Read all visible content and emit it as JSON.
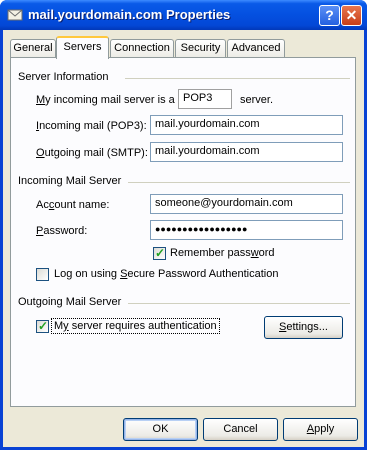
{
  "window": {
    "title": "mail.yourdomain.com Properties",
    "help_glyph": "?",
    "close_glyph": "✕"
  },
  "tabs": [
    {
      "label": "General"
    },
    {
      "label": "Servers"
    },
    {
      "label": "Connection"
    },
    {
      "label": "Security"
    },
    {
      "label": "Advanced"
    }
  ],
  "server_info": {
    "heading": "Server Information",
    "server_type_prefix": "y incoming mail server is a",
    "server_type_accel": "M",
    "server_type_value": "POP3",
    "server_type_suffix": "server.",
    "incoming_label_accel": "I",
    "incoming_label_rest": "ncoming mail (POP3):",
    "incoming_value": "mail.yourdomain.com",
    "outgoing_label_accel": "O",
    "outgoing_label_rest": "utgoing mail (SMTP):",
    "outgoing_value": "mail.yourdomain.com"
  },
  "incoming_server": {
    "heading": "Incoming Mail Server",
    "account_label_rest_pre": "Ac",
    "account_label_accel": "c",
    "account_label_rest_post": "ount name:",
    "account_value": "someone@yourdomain.com",
    "password_label_accel": "P",
    "password_label_rest": "assword:",
    "password_value": "●●●●●●●●●●●●●●●●●",
    "remember_pre": "Remember pass",
    "remember_accel": "w",
    "remember_post": "ord",
    "remember_checked": true,
    "spa_pre": "Log on using ",
    "spa_accel": "S",
    "spa_post": "ecure Password Authentication",
    "spa_checked": false
  },
  "outgoing_server": {
    "heading": "Outgoing Mail Server",
    "auth_pre": "M",
    "auth_accel": "y",
    "auth_post": " server requires authentication",
    "auth_checked": true,
    "settings_label_accel": "S",
    "settings_label_rest": "ettings..."
  },
  "buttons": {
    "ok": "OK",
    "cancel": "Cancel",
    "apply_accel": "A",
    "apply_rest": "pply"
  },
  "colors": {
    "titlebar": "#0450e0",
    "face": "#ece9d8",
    "panel": "#fcfcfe",
    "check": "#21a121"
  }
}
